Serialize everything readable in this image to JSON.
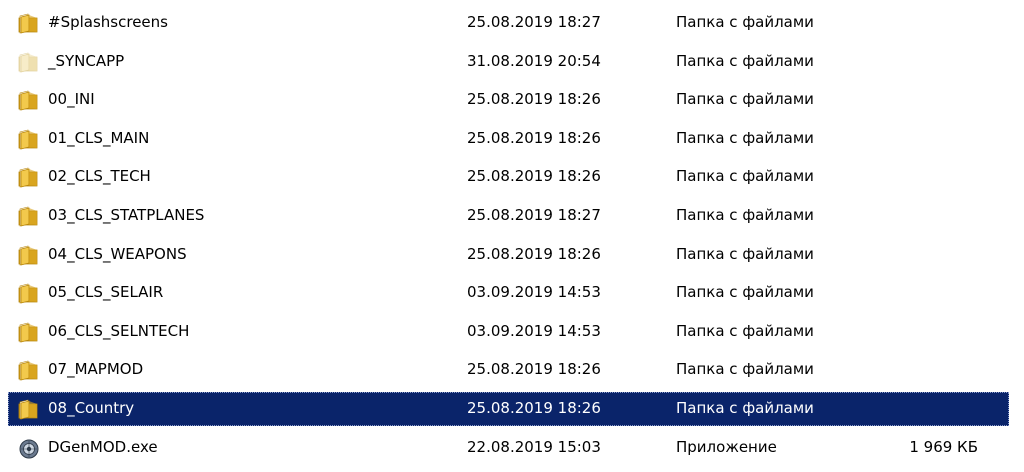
{
  "files": [
    {
      "name": "#Splashscreens",
      "date": "25.08.2019 18:27",
      "type": "Папка с файлами",
      "size": "",
      "icon": "folder-icon",
      "selected": false,
      "faded": false
    },
    {
      "name": "_SYNCAPP",
      "date": "31.08.2019 20:54",
      "type": "Папка с файлами",
      "size": "",
      "icon": "folder-icon",
      "selected": false,
      "faded": true
    },
    {
      "name": "00_INI",
      "date": "25.08.2019 18:26",
      "type": "Папка с файлами",
      "size": "",
      "icon": "folder-icon",
      "selected": false,
      "faded": false
    },
    {
      "name": "01_CLS_MAIN",
      "date": "25.08.2019 18:26",
      "type": "Папка с файлами",
      "size": "",
      "icon": "folder-icon",
      "selected": false,
      "faded": false
    },
    {
      "name": "02_CLS_TECH",
      "date": "25.08.2019 18:26",
      "type": "Папка с файлами",
      "size": "",
      "icon": "folder-icon",
      "selected": false,
      "faded": false
    },
    {
      "name": "03_CLS_STATPLANES",
      "date": "25.08.2019 18:27",
      "type": "Папка с файлами",
      "size": "",
      "icon": "folder-icon",
      "selected": false,
      "faded": false
    },
    {
      "name": "04_CLS_WEAPONS",
      "date": "25.08.2019 18:26",
      "type": "Папка с файлами",
      "size": "",
      "icon": "folder-icon",
      "selected": false,
      "faded": false
    },
    {
      "name": "05_CLS_SELAIR",
      "date": "03.09.2019 14:53",
      "type": "Папка с файлами",
      "size": "",
      "icon": "folder-icon",
      "selected": false,
      "faded": false
    },
    {
      "name": "06_CLS_SELNTECH",
      "date": "03.09.2019 14:53",
      "type": "Папка с файлами",
      "size": "",
      "icon": "folder-icon",
      "selected": false,
      "faded": false
    },
    {
      "name": "07_MAPMOD",
      "date": "25.08.2019 18:26",
      "type": "Папка с файлами",
      "size": "",
      "icon": "folder-icon",
      "selected": false,
      "faded": false
    },
    {
      "name": "08_Country",
      "date": "25.08.2019 18:26",
      "type": "Папка с файлами",
      "size": "",
      "icon": "folder-icon",
      "selected": true,
      "faded": false
    },
    {
      "name": "DGenMOD.exe",
      "date": "22.08.2019 15:03",
      "type": "Приложение",
      "size": "1 969 КБ",
      "icon": "application-icon",
      "selected": false,
      "faded": false
    }
  ],
  "colors": {
    "selection": "#0a246a",
    "folder_front": "#f2c94c",
    "folder_back": "#d9a520"
  }
}
